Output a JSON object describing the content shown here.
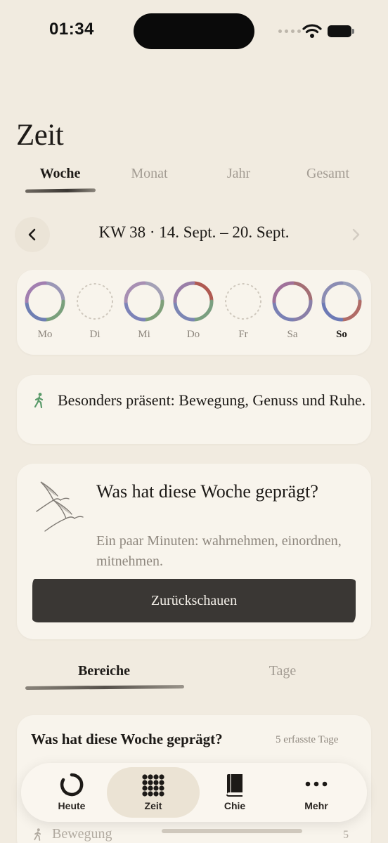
{
  "status": {
    "time": "01:34"
  },
  "page": {
    "title": "Zeit"
  },
  "period_tabs": [
    {
      "label": "Woche",
      "active": true
    },
    {
      "label": "Monat",
      "active": false
    },
    {
      "label": "Jahr",
      "active": false
    },
    {
      "label": "Gesamt",
      "active": false
    }
  ],
  "week_nav": {
    "label": "KW 38 · 14. Sept. – 20. Sept."
  },
  "days": [
    {
      "label": "Mo",
      "filled": true,
      "today": false
    },
    {
      "label": "Di",
      "filled": false,
      "today": false
    },
    {
      "label": "Mi",
      "filled": true,
      "today": false
    },
    {
      "label": "Do",
      "filled": true,
      "today": false
    },
    {
      "label": "Fr",
      "filled": false,
      "today": false
    },
    {
      "label": "Sa",
      "filled": true,
      "today": false
    },
    {
      "label": "So",
      "filled": true,
      "today": true
    }
  ],
  "present": {
    "text": "Besonders präsent: Bewegung, Genuss und Ruhe."
  },
  "reflect": {
    "title": "Was hat diese Woche geprägt?",
    "subtitle": "Ein paar Minuten: wahrnehmen, einordnen, mitnehmen.",
    "button_label": "Zurückschauen"
  },
  "sub_tabs": [
    {
      "label": "Bereiche",
      "active": true
    },
    {
      "label": "Tage",
      "active": false
    }
  ],
  "list": {
    "title": "Was hat diese Woche geprägt?",
    "count": "5 erfasste Tage",
    "rows": [
      {
        "label": "Bewegung",
        "value": "5"
      }
    ]
  },
  "tabbar": [
    {
      "label": "Heute",
      "icon": "heute-ring-icon"
    },
    {
      "label": "Zeit",
      "icon": "grid-dots-icon",
      "active": true
    },
    {
      "label": "Chie",
      "icon": "book-icon"
    },
    {
      "label": "Mehr",
      "icon": "more-dots-icon"
    }
  ],
  "colors": {
    "background": "#f1ebe0",
    "card": "#f8f4ec",
    "button": "#3a3734",
    "muted_text": "#a39c93"
  }
}
